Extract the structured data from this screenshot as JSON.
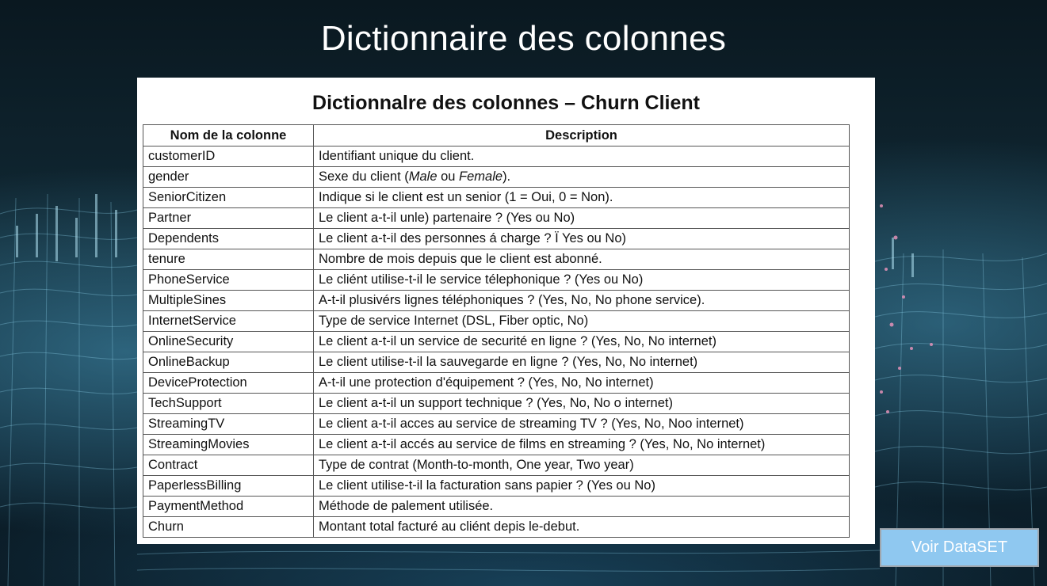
{
  "slide": {
    "title": "Dictionnaire des colonnes"
  },
  "card": {
    "title": "Dictionnalre des colonnes – Churn Client",
    "headers": [
      "Nom de la colonne",
      "Description"
    ],
    "rows": [
      {
        "name": "customerID",
        "description": "Identifiant unique du client."
      },
      {
        "name": "gender",
        "description_parts": [
          "Sexe du client (",
          "Male",
          " ou ",
          "Female",
          ")."
        ]
      },
      {
        "name": "SeniorCitizen",
        "description": "Indique si le client est un senior (1 = Oui,  0 = Non)."
      },
      {
        "name": "Partner",
        "description": "Le client a-t-il unle) partenaire ? (Yes ou No)"
      },
      {
        "name": "Dependents",
        "description": "Le client a-t-il des personnes á charge ?  Ï Yes ou No)"
      },
      {
        "name": "tenure",
        "description": "Nombre de mois depuis que le client est abonné."
      },
      {
        "name": "PhoneService",
        "description": "Le cliént utilise-t-il le service télephonique ?  (Yes ou No)"
      },
      {
        "name": "MultipleSines",
        "description": "A-t-il plusivérs lignes téléphoniques ? (Yes, No, No phone service)."
      },
      {
        "name": "InternetService",
        "description": "Type de service Internet (DSL, Fiber optic, No)"
      },
      {
        "name": "OnlineSecurity",
        "description": "Le client a-t-il un service de securité en ligne ? (Yes,  No, No internet)"
      },
      {
        "name": "OnlineBackup",
        "description": "Le client utilise-t-il la sauvegarde en ligne ? (Yes, No, No internet)"
      },
      {
        "name": "DeviceProtection",
        "description": "A-t-il une protection d'équipement ? (Yes, No, No internet)"
      },
      {
        "name": "TechSupport",
        "description": "Le client a-t-il un support technique ? (Yes, No, No o internet)"
      },
      {
        "name": "StreamingTV",
        "description": "Le client a-t-il acces au service de streaming TV ? (Yes, No, Noo internet)"
      },
      {
        "name": "StreamingMovies",
        "description": "Le client a-t-il accés au service de films en streaming ? (Yes, No, No internet)"
      },
      {
        "name": "Contract",
        "description": "Type de contrat (Month-to-month, One year, Two year)"
      },
      {
        "name": "PaperlessBilling",
        "description": "Le client utilise-t-il la facturation sans papier ? (Yes ou No)"
      },
      {
        "name": "PaymentMethod",
        "description": "Méthode de palement utilisée."
      },
      {
        "name": "Churn",
        "description": "Montant total facturé au cliént  depis le-debut."
      }
    ]
  },
  "button": {
    "label": "Voir DataSET"
  },
  "colors": {
    "background": "#0d2330",
    "button": "#8fc8f0",
    "card": "#ffffff"
  }
}
